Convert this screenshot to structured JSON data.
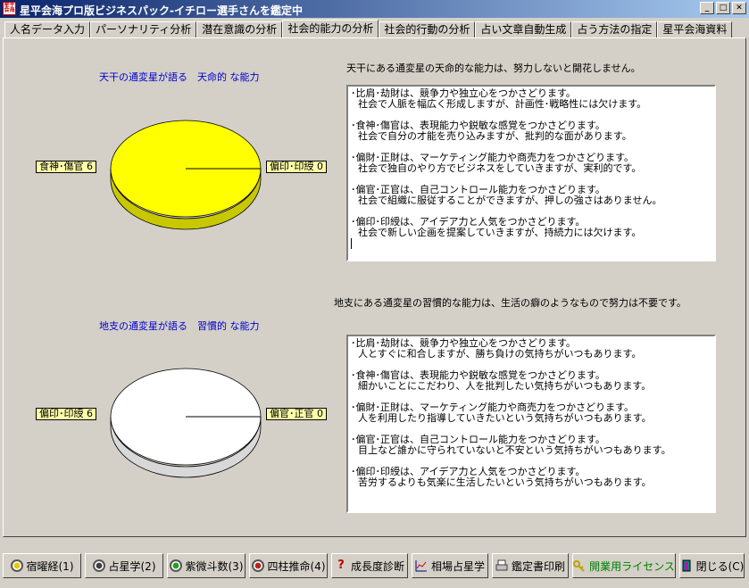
{
  "window": {
    "title": "星平会海プロ版ビジネスパック-イチロー選手さんを鑑定中",
    "icon_text": "星平会海"
  },
  "tabs": [
    {
      "label": "人名データ入力"
    },
    {
      "label": "パーソナリティ分析"
    },
    {
      "label": "潜在意識の分析"
    },
    {
      "label": "社会的能力の分析",
      "active": true
    },
    {
      "label": "社会的行動の分析"
    },
    {
      "label": "占い文章自動生成"
    },
    {
      "label": "占う方法の指定"
    },
    {
      "label": "星平会海資料"
    }
  ],
  "section1": {
    "chart_title": "天干の通変星が語る　天命的 な能力",
    "description": "天干にある通変星の天命的な能力は、努力しないと開花しません。",
    "pie_color": "#ffff00",
    "labels": {
      "left": "食神･傷官 6",
      "right": "偏印･印綬 0"
    },
    "entries": [
      {
        "title": "･比肩･劫財は、競争力や独立心をつかさどります。",
        "detail": "社会で人脈を幅広く形成しますが、計画性･戦略性には欠けます。"
      },
      {
        "title": "･食神･傷官は、表現能力や鋭敏な感覚をつかさどります。",
        "detail": "社会で自分の才能を売り込みますが、批判的な面があります。"
      },
      {
        "title": "･偏財･正財は、マーケティング能力や商売力をつかさどります。",
        "detail": "社会で独自のやり方でビジネスをしていきますが、実利的です。"
      },
      {
        "title": "･偏官･正官は、自己コントロール能力をつかさどります。",
        "detail": "社会で組織に服従することができますが、押しの強さはありません。"
      },
      {
        "title": "･偏印･印綬は、アイデア力と人気をつかさどります。",
        "detail": "社会で新しい企画を提案していきますが、持続力には欠けます。"
      }
    ]
  },
  "section2": {
    "chart_title": "地支の通変星が語る　習慣的 な能力",
    "description": "地支にある通変星の習慣的な能力は、生活の癖のようなもので努力は不要です。",
    "pie_color": "#ffffff",
    "labels": {
      "left": "偏印･印綬 6",
      "right": "偏官･正官 0"
    },
    "entries": [
      {
        "title": "･比肩･劫財は、競争力や独立心をつかさどります。",
        "detail": "人とすぐに和合しますが、勝ち負けの気持ちがいつもあります。"
      },
      {
        "title": "･食神･傷官は、表現能力や鋭敏な感覚をつかさどります。",
        "detail": "細かいことにこだわり、人を批判したい気持ちがいつもあります。"
      },
      {
        "title": "･偏財･正財は、マーケティング能力や商売力をつかさどります。",
        "detail": "人を利用したり指導していきたいという気持ちがいつもあります。"
      },
      {
        "title": "･偏官･正官は、自己コントロール能力をつかさどります。",
        "detail": "目上など誰かに守られていないと不安という気持ちがいつもあります。"
      },
      {
        "title": "･偏印･印綬は、アイデア力と人気をつかさどります。",
        "detail": "苦労するよりも気楽に生活したいという気持ちがいつもあります。"
      }
    ]
  },
  "buttons": [
    {
      "label": "宿曜経(1)",
      "icon": "yellow-circle-icon",
      "color": "#e8c800"
    },
    {
      "label": "占星学(2)",
      "icon": "dark-circle-icon",
      "color": "#404040"
    },
    {
      "label": "紫微斗数(3)",
      "icon": "green-circle-icon",
      "color": "#20a020"
    },
    {
      "label": "四柱推命(4)",
      "icon": "red-circle-icon",
      "color": "#c02020"
    },
    {
      "label": "成長度診断",
      "icon": "question-icon",
      "color": "#c00000"
    },
    {
      "label": "相場占星学",
      "icon": "chart-icon",
      "color": "#000080"
    },
    {
      "label": "鑑定書印刷",
      "icon": "printer-icon",
      "color": "#404040"
    },
    {
      "label": "開業用ライセンス",
      "icon": "key-icon",
      "color": "#c0a000",
      "highlight": true
    },
    {
      "label": "閉じる(C)",
      "icon": "door-icon",
      "color": "#008080"
    }
  ]
}
